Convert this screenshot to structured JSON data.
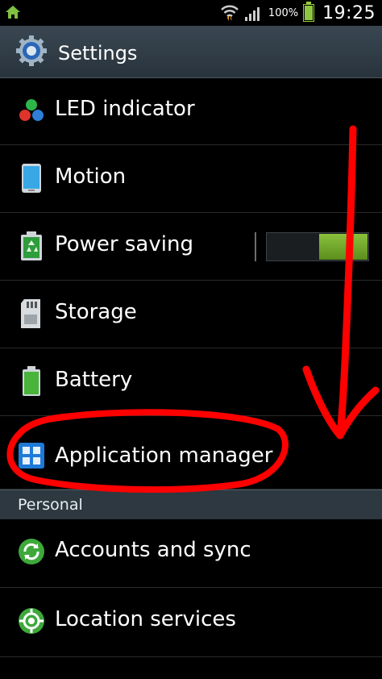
{
  "status_bar": {
    "battery_percent": "100%",
    "time": "19:25"
  },
  "action_bar": {
    "title": "Settings",
    "icon": "gear-icon"
  },
  "rows": [
    {
      "label": "LED indicator",
      "icon": "led-indicator-icon"
    },
    {
      "label": "Motion",
      "icon": "motion-phone-icon"
    },
    {
      "label": "Power saving",
      "icon": "recycle-icon",
      "toggle_on": true
    },
    {
      "label": "Storage",
      "icon": "sd-card-icon"
    },
    {
      "label": "Battery",
      "icon": "battery-icon"
    },
    {
      "label": "Application manager",
      "icon": "apps-grid-icon"
    }
  ],
  "section": {
    "label": "Personal"
  },
  "personal_rows": [
    {
      "label": "Accounts and sync",
      "icon": "sync-icon"
    },
    {
      "label": "Location services",
      "icon": "location-icon"
    }
  ],
  "annotation": {
    "color": "#ff0000"
  }
}
